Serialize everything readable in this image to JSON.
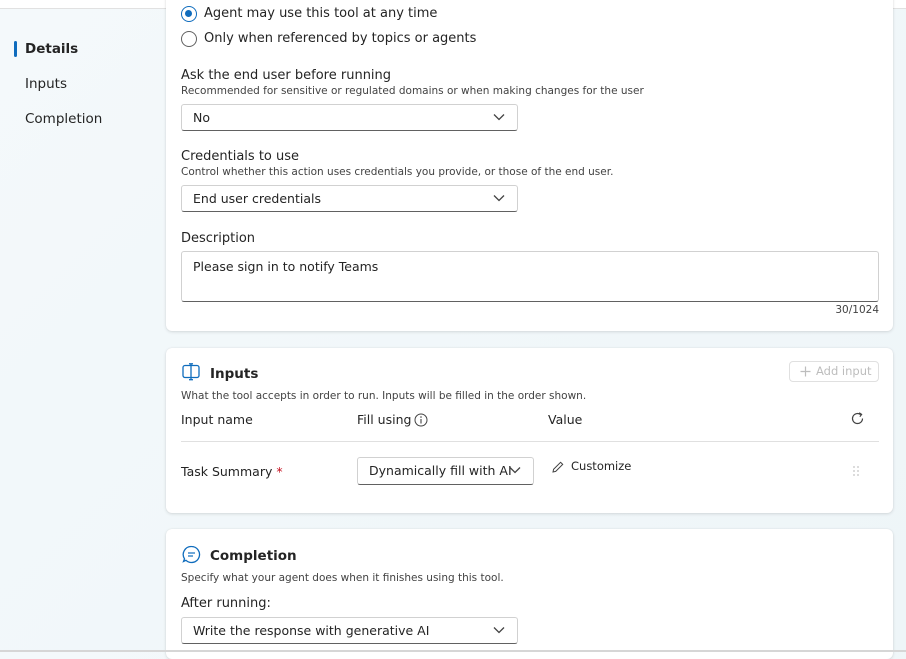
{
  "nav": {
    "items": [
      {
        "label": "Details",
        "active": true
      },
      {
        "label": "Inputs",
        "active": false
      },
      {
        "label": "Completion",
        "active": false
      }
    ]
  },
  "details": {
    "availability": {
      "options": [
        "Agent may use this tool at any time",
        "Only when referenced by topics or agents"
      ],
      "selected": 0
    },
    "ask_user": {
      "label": "Ask the end user before running",
      "help": "Recommended for sensitive or regulated domains or when making changes for the user",
      "value": "No"
    },
    "credentials": {
      "label": "Credentials to use",
      "help": "Control whether this action uses credentials you provide, or those of the end user.",
      "value": "End user credentials"
    },
    "description": {
      "label": "Description",
      "value": "Please sign in to notify Teams",
      "counter": "30/1024"
    }
  },
  "inputs": {
    "title": "Inputs",
    "subtitle": "What the tool accepts in order to run. Inputs will be filled in the order shown.",
    "add_button": "Add input",
    "columns": [
      "Input name",
      "Fill using",
      "Value"
    ],
    "rows": [
      {
        "name": "Task Summary",
        "required_mark": "*",
        "fill_using": "Dynamically fill with AI",
        "value_action": "Customize"
      }
    ]
  },
  "completion": {
    "title": "Completion",
    "subtitle": "Specify what your agent does when it finishes using this tool.",
    "after_label": "After running:",
    "after_value": "Write the response with generative AI"
  },
  "colors": {
    "accent": "#0f6cbd",
    "required": "#c50f1f"
  }
}
